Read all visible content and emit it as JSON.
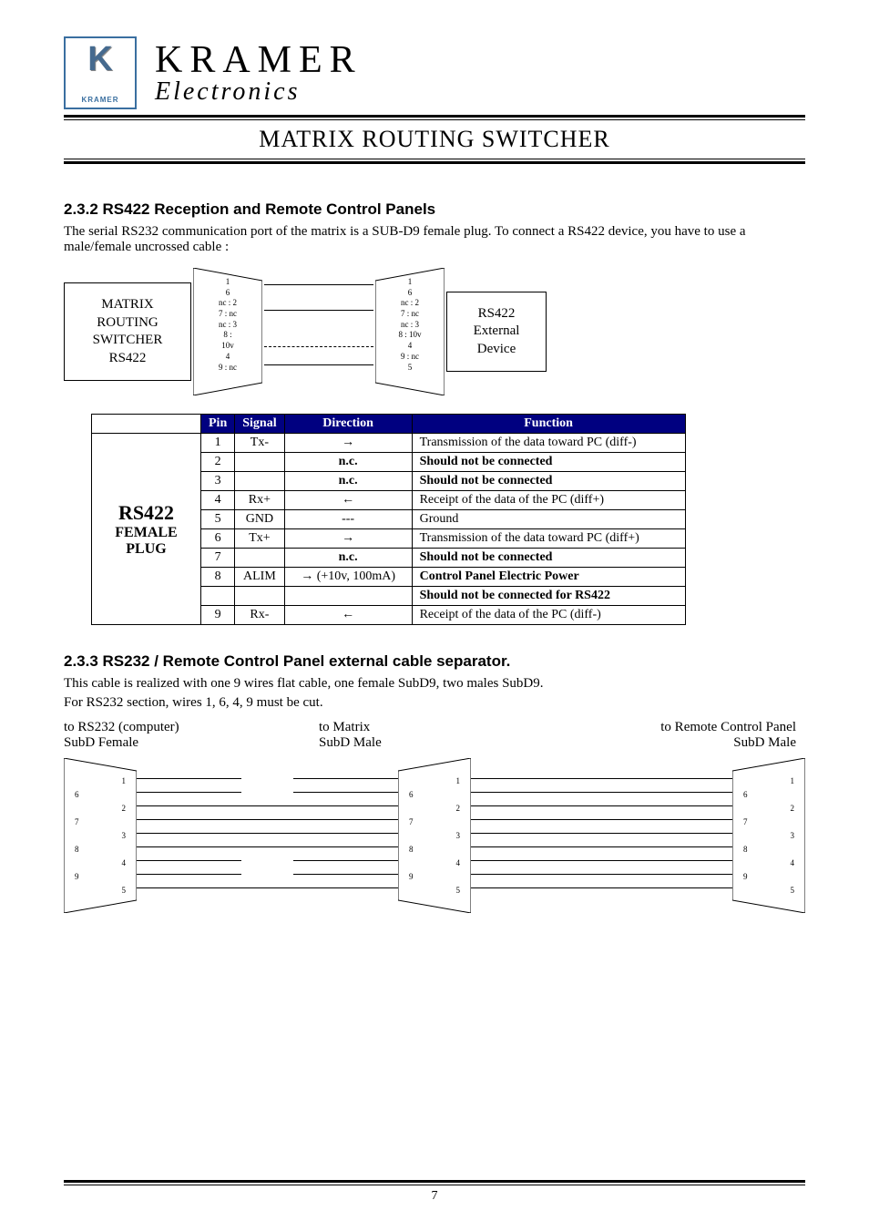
{
  "brand": {
    "name": "KRAMER",
    "sub": "Electronics",
    "logo_sub": "KRAMER"
  },
  "page_title": "MATRIX ROUTING SWITCHER",
  "sec232": {
    "heading": "2.3.2  RS422 Reception and Remote Control Panels",
    "p1": "The serial RS232 communication port of the matrix is a SUB-D9 female plug. To connect a RS422 device, you have to use a male/female uncrossed cable :"
  },
  "diag1": {
    "left_box": "MATRIX\nROUTING\nSWITCHER\nRS422",
    "right_box": "RS422\nExternal\nDevice",
    "left_conn": [
      "1",
      "6",
      "nc : 2",
      "7 : nc",
      "nc : 3",
      "8 :",
      "10v",
      "4",
      "9 : nc"
    ],
    "right_conn": [
      "1",
      "6",
      "nc : 2",
      "7 : nc",
      "nc : 3",
      "8 : 10v",
      "4",
      "9 : nc",
      "5"
    ]
  },
  "pin_table": {
    "headers": [
      "Pin",
      "Signal",
      "Direction",
      "Function"
    ],
    "row_label": {
      "big": "RS422",
      "l2": "FEMALE",
      "l3": "PLUG"
    },
    "rows": [
      {
        "pin": "1",
        "signal": "Tx-",
        "dir": "→",
        "func": "Transmission of the data toward PC (diff-)",
        "bold": false,
        "nc": false
      },
      {
        "pin": "2",
        "signal": "",
        "dir": "n.c.",
        "func": "Should not be connected",
        "bold": true,
        "nc": true
      },
      {
        "pin": "3",
        "signal": "",
        "dir": "n.c.",
        "func": "Should not be connected",
        "bold": true,
        "nc": true
      },
      {
        "pin": "4",
        "signal": "Rx+",
        "dir": "←",
        "func": "Receipt of the data of the PC (diff+)",
        "bold": false,
        "nc": false
      },
      {
        "pin": "5",
        "signal": "GND",
        "dir": "---",
        "func": "Ground",
        "bold": false,
        "nc": false
      },
      {
        "pin": "6",
        "signal": "Tx+",
        "dir": "→",
        "func": "Transmission of the data toward PC (diff+)",
        "bold": false,
        "nc": false
      },
      {
        "pin": "7",
        "signal": "",
        "dir": "n.c.",
        "func": "Should not be connected",
        "bold": true,
        "nc": true
      },
      {
        "pin": "8",
        "signal": "ALIM",
        "dir": "→ (+10v, 100mA)",
        "func": "Control Panel Electric Power",
        "bold": true,
        "nc": false
      },
      {
        "pin": "",
        "signal": "",
        "dir": "",
        "func": "Should not be connected for RS422",
        "bold": true,
        "nc": false
      },
      {
        "pin": "9",
        "signal": "Rx-",
        "dir": "←",
        "func": "Receipt of the data of the PC (diff-)",
        "bold": false,
        "nc": false
      }
    ]
  },
  "sec233": {
    "heading": "2.3.3 RS232 / Remote Control Panel  external cable separator.",
    "p1": "This cable is realized with one 9 wires flat cable, one female SubD9, two males SubD9.",
    "p2": "For RS232 section, wires 1, 6, 4, 9 must be cut."
  },
  "diag2": {
    "labels": [
      "to RS232 (computer)",
      "to Matrix",
      "to Remote Control Panel"
    ],
    "subs": [
      "SubD Female",
      "SubD Male",
      "SubD Male"
    ],
    "pins_left": [
      "1",
      "6",
      "2",
      "7",
      "3",
      "8",
      "4",
      "9",
      "5"
    ],
    "pins_mid": [
      "1",
      "6",
      "2",
      "7",
      "3",
      "8",
      "4",
      "9",
      "5"
    ],
    "pins_right": [
      "1",
      "6",
      "2",
      "7",
      "3",
      "8",
      "4",
      "9",
      "5"
    ]
  },
  "page_number": "7"
}
